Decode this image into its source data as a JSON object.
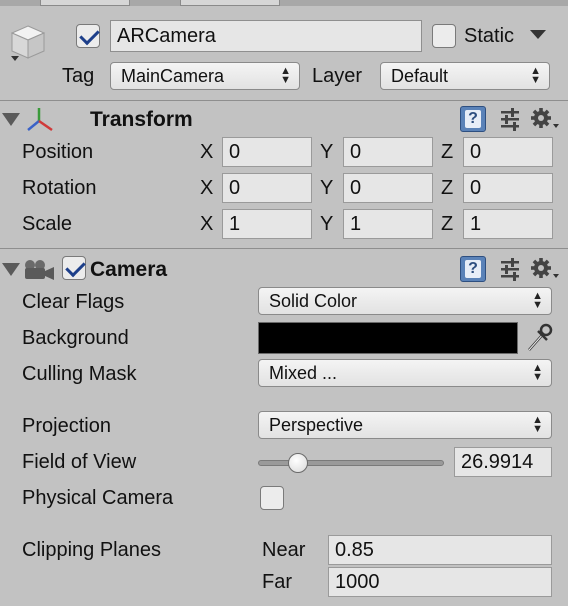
{
  "object": {
    "active": true,
    "name": "ARCamera",
    "static_label": "Static",
    "static_checked": false,
    "tag_label": "Tag",
    "tag_value": "MainCamera",
    "layer_label": "Layer",
    "layer_value": "Default"
  },
  "transform": {
    "title": "Transform",
    "rows": [
      {
        "label": "Position",
        "x": "0",
        "y": "0",
        "z": "0"
      },
      {
        "label": "Rotation",
        "x": "0",
        "y": "0",
        "z": "0"
      },
      {
        "label": "Scale",
        "x": "1",
        "y": "1",
        "z": "1"
      }
    ],
    "axis_labels": [
      "X",
      "Y",
      "Z"
    ]
  },
  "camera": {
    "title": "Camera",
    "enabled": true,
    "clear_flags_label": "Clear Flags",
    "clear_flags_value": "Solid Color",
    "background_label": "Background",
    "background_color": "#000000",
    "culling_mask_label": "Culling Mask",
    "culling_mask_value": "Mixed ...",
    "projection_label": "Projection",
    "projection_value": "Perspective",
    "fov_label": "Field of View",
    "fov_value": "26.9914",
    "fov_slider_fraction": 0.18,
    "physical_camera_label": "Physical Camera",
    "physical_camera_checked": false,
    "clipping_label": "Clipping Planes",
    "near_label": "Near",
    "near_value": "0.85",
    "far_label": "Far",
    "far_value": "1000"
  },
  "icons": {
    "help": "help-book-icon",
    "presets": "preset-sliders-icon",
    "gear": "gear-icon",
    "cube": "gameobject-cube-icon",
    "transform": "transform-axes-icon",
    "camera": "camera-icon",
    "eyedropper": "eyedropper-icon"
  },
  "colors": {
    "panel_bg": "#c2c2c2",
    "field_bg": "#e6e6e6",
    "checkbox_tick": "#1d3f8a",
    "help_icon": "#5a82b8"
  }
}
